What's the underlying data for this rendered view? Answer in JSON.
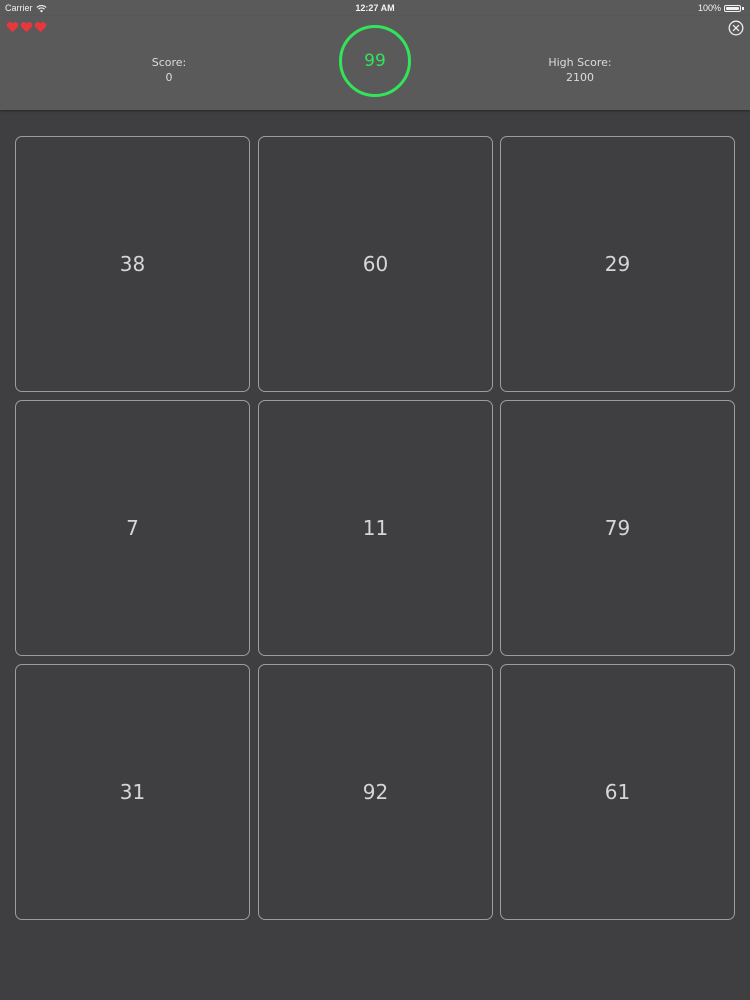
{
  "status_bar": {
    "carrier": "Carrier",
    "time": "12:27 AM",
    "battery_percent": "100%",
    "battery_level": 1.0
  },
  "header": {
    "lives": 3,
    "lives_color": "#e8383d",
    "score_label": "Score:",
    "score_value": "0",
    "timer_value": "99",
    "timer_color": "#32e45a",
    "high_score_label": "High Score:",
    "high_score_value": "2100",
    "close_icon": "close-circle-icon"
  },
  "grid": {
    "tiles": [
      "38",
      "60",
      "29",
      "7",
      "11",
      "79",
      "31",
      "92",
      "61"
    ]
  }
}
